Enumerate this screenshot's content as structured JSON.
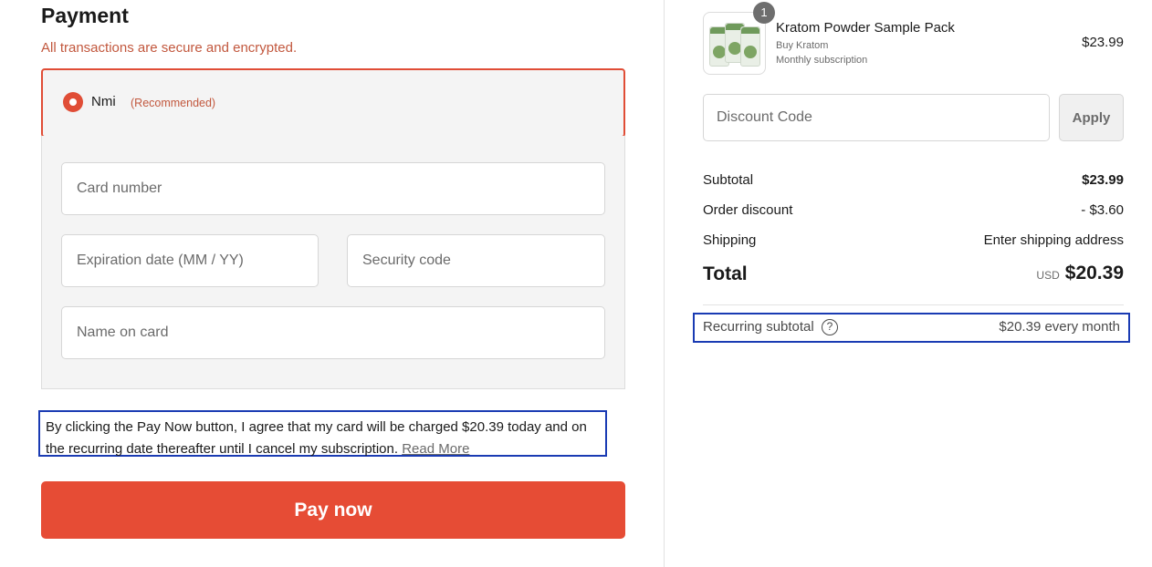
{
  "payment": {
    "title": "Payment",
    "subtitle": "All transactions are secure and encrypted.",
    "method": {
      "name": "Nmi",
      "tag": "(Recommended)"
    },
    "fields": {
      "card_number": "Card number",
      "expiration": "Expiration date (MM / YY)",
      "security_code": "Security code",
      "name_on_card": "Name on card"
    },
    "consent": {
      "text": "By clicking the Pay Now button, I agree that my card will be charged $20.39 today and on the recurring date thereafter until I cancel my subscription.",
      "link": "Read More"
    },
    "pay_button": "Pay now"
  },
  "summary": {
    "product": {
      "quantity": "1",
      "name": "Kratom Powder Sample Pack",
      "vendor": "Buy Kratom",
      "plan": "Monthly subscription",
      "price": "$23.99",
      "icon": "product-thumbnail"
    },
    "discount": {
      "placeholder": "Discount Code",
      "apply_label": "Apply"
    },
    "rows": {
      "subtotal_label": "Subtotal",
      "subtotal_value": "$23.99",
      "discount_label": "Order discount",
      "discount_value": "- $3.60",
      "shipping_label": "Shipping",
      "shipping_value": "Enter shipping address"
    },
    "total": {
      "label": "Total",
      "currency": "USD",
      "value": "$20.39"
    },
    "recurring": {
      "label": "Recurring subtotal",
      "icon": "question-icon",
      "value": "$20.39 every month"
    }
  },
  "colors": {
    "accent": "#e64c35",
    "subtitle": "#c2583e",
    "highlight_border": "#1a3bb3",
    "panel_bg": "#f4f4f4"
  }
}
